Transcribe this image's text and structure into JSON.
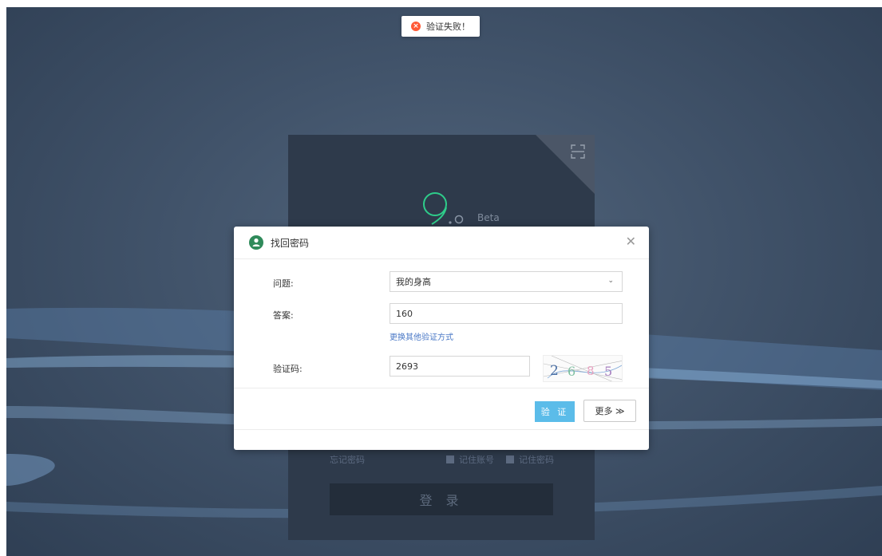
{
  "toast": {
    "icon": "error-icon",
    "text": "验证失败！"
  },
  "login": {
    "logo_text": "Beta",
    "forget_password": "忘记密码",
    "remember_account": "记住账号",
    "remember_password": "记住密码",
    "login_button": "登 录"
  },
  "modal": {
    "title": "找回密码",
    "question_label": "问题:",
    "question_value": "我的身高",
    "answer_label": "答案:",
    "answer_value": "160",
    "change_method_link": "更换其他验证方式",
    "captcha_label": "验证码:",
    "captcha_value": "2693",
    "captcha_image_text": "2 6 8 5",
    "verify_button": "验 证",
    "more_button": "更多 ≫"
  },
  "colors": {
    "accent": "#5bbce9",
    "error": "#ff5a36",
    "link": "#4a78c6",
    "panel": "#2e3a4b"
  }
}
